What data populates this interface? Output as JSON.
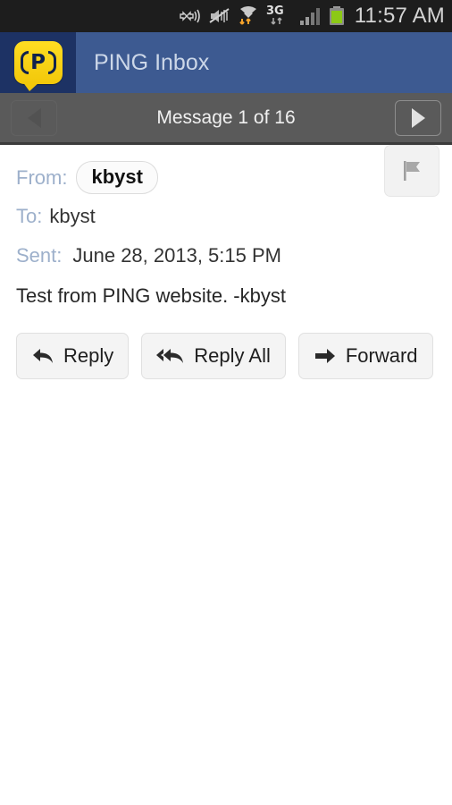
{
  "status_bar": {
    "time": "11:57 AM",
    "icons": [
      "gps-location-icon",
      "volume-mute-icon",
      "wifi-data-icon",
      "3g-data-icon",
      "cellular-signal-icon",
      "battery-icon"
    ],
    "network_label": "3G",
    "background": "#1d1d1d",
    "battery_color": "#8cc916"
  },
  "header": {
    "title": "PING Inbox",
    "logo_letter": "P",
    "logo_bg": "#f2c80a",
    "bar_color": "#3d5a91",
    "logo_block_color": "#1d3264"
  },
  "nav": {
    "title": "Message 1 of 16",
    "prev_label": "Previous message",
    "next_label": "Next message",
    "bar_color": "#5a5a5a"
  },
  "message": {
    "from_label": "From:",
    "from_value": "kbyst",
    "to_label": "To:",
    "to_value": "kbyst",
    "sent_label": "Sent:",
    "sent_value": "June 28, 2013, 5:15 PM",
    "body": "Test from PING website. -kbyst",
    "flag_label": "Flag message"
  },
  "actions": [
    {
      "label": "Reply",
      "icon": "reply-arrow-icon"
    },
    {
      "label": "Reply All",
      "icon": "reply-all-arrow-icon"
    },
    {
      "label": "Forward",
      "icon": "forward-arrow-icon"
    }
  ]
}
